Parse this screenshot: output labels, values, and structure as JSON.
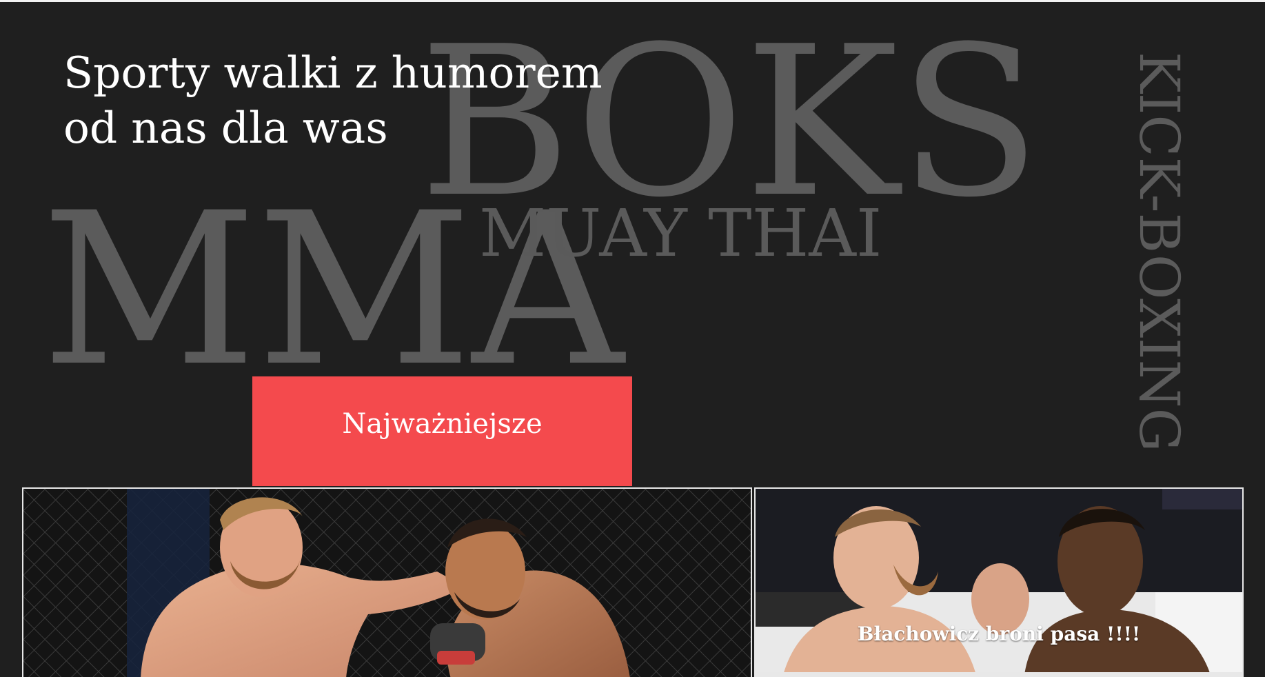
{
  "hero": {
    "title_line1": "Sporty walki z humorem",
    "title_line2": "od nas dla was"
  },
  "background_words": {
    "boks": "BOKS",
    "muay_thai": "MUAY THAI",
    "mma": "MMA",
    "kick_boxing": "KICK-BOXING"
  },
  "cta": {
    "label": "Najważniejsze"
  },
  "articles": [
    {
      "image": "fighter-punch-photo",
      "caption": ""
    },
    {
      "image": "weigh-in-faceoff-photo",
      "caption": "Błachowicz broni pasa !!!!"
    }
  ],
  "colors": {
    "background": "#1f1f1f",
    "accent": "#f44a4d",
    "background_text": "#5b5b5b",
    "title_text": "#ffffff"
  }
}
